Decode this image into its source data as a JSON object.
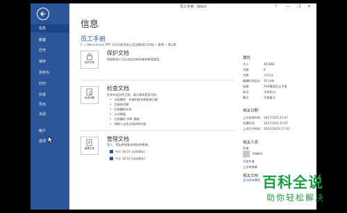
{
  "window": {
    "title": "员工手册 - Word",
    "controls": [
      "?",
      "—",
      "❐",
      "✕"
    ]
  },
  "nav": {
    "items": [
      {
        "label": "信息",
        "active": true
      },
      {
        "label": "新建"
      },
      {
        "label": "打开"
      },
      {
        "label": "保存"
      },
      {
        "label": "另存为"
      },
      {
        "label": "打印"
      },
      {
        "label": "共享"
      },
      {
        "label": "导出"
      },
      {
        "label": "关闭"
      },
      {
        "label": "帐户"
      },
      {
        "label": "选项"
      }
    ]
  },
  "info": {
    "heading": "信息",
    "doc_title": "员工手册",
    "path": "F: » Word Excel PPT 2016商务办公实战秘技250招 » 素材 » 第1章"
  },
  "protect": {
    "tile_label": "保护文档",
    "title": "保护文档",
    "desc": "控制其他人可以对此文档所做的更改类型。"
  },
  "inspect": {
    "tile_label": "检查问题",
    "title": "检查文档",
    "desc": "在发布此文件之前，请注意其是否包含:",
    "bullets": [
      "文档属性、作者的姓名和相关日期",
      "页眉和页脚",
      "已隐藏的文本",
      "公司数据",
      "已隐藏的 XML 数据",
      "残障人士无法阅读的内容"
    ]
  },
  "manage": {
    "tile_label": "管理文档",
    "title": "管理文档",
    "desc": "签入、签出并恢复未保存的更改。",
    "versions": [
      "今天 16:37 (自动保存)",
      "今天 16:14 (自动保存)"
    ]
  },
  "properties": {
    "heading": "属性",
    "rows": [
      {
        "k": "大小",
        "v": "40.6KB"
      },
      {
        "k": "页数",
        "v": "6"
      },
      {
        "k": "字数",
        "v": "11513"
      },
      {
        "k": "编辑时间总计",
        "v": "50 分钟"
      },
      {
        "k": "标题",
        "v": "XXX集团员工手册"
      },
      {
        "k": "标记",
        "v": "添加标记",
        "link": true
      },
      {
        "k": "备注",
        "v": "添加备注",
        "link": true
      }
    ],
    "dates_heading": "相关日期",
    "dates": [
      {
        "k": "上次修改时间",
        "v": "2017/3/15 21:07"
      },
      {
        "k": "创建时间",
        "v": "2017/3/15 21:07"
      },
      {
        "k": "上次打印时间",
        "v": "2001/10/24 17:41"
      }
    ],
    "people_heading": "相关人员",
    "author_label": "作者",
    "author_add": "添加作者",
    "user_name": "Users",
    "last_modified_label": "上次修改者",
    "docs_heading": "相关文档",
    "show_all": "显示所有属性"
  },
  "watermark": {
    "title": "百科全说",
    "subtitle": "助你轻松解决"
  }
}
